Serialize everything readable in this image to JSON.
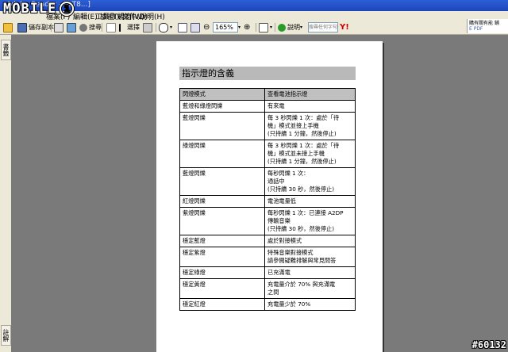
{
  "logo": {
    "text": "MOBILE"
  },
  "window": {
    "title": "Adobe Reader - [DT8...]"
  },
  "menu": [
    "檔案(F)",
    "編輯(E)",
    "檢視(V)",
    "文件(D)",
    "工具(T)",
    "視窗(W)",
    "說明(H)"
  ],
  "toolbar": {
    "save_copy": "儲存副本",
    "search": "搜尋",
    "select": "選擇",
    "zoom_value": "165%",
    "help": "說明",
    "search_placeholder": "搜尋任何字句"
  },
  "right_panel": {
    "line1": "購有關有能 鋪",
    "line2": "E PDF"
  },
  "left_tabs": {
    "top": "書籤",
    "bottom": "註解"
  },
  "document": {
    "heading": "指示燈的含義",
    "headers": [
      "閃燈模式",
      "查看電池指示燈"
    ],
    "rows": [
      {
        "mode": "藍燈和綠燈閃爍",
        "desc": [
          "有來電"
        ]
      },
      {
        "mode": "藍燈閃爍",
        "desc": [
          "每 3 秒閃爍 1 次：處於「待",
          "機」模式並接上手機",
          "(只持續 1 分鐘，然後停止)"
        ]
      },
      {
        "mode": "綠燈閃爍",
        "desc": [
          "每 3 秒閃爍 1 次：處於「待",
          "機」模式並未接上手機",
          "(只持續 1 分鐘，然後停止)"
        ]
      },
      {
        "mode": "藍燈閃爍",
        "desc": [
          "每秒閃爍 1 次：",
          "通話中",
          "(只持續 30 秒，然後停止)"
        ]
      },
      {
        "mode": "紅燈閃爍",
        "desc": [
          "電池電量低"
        ]
      },
      {
        "mode": "紫燈閃爍",
        "desc": [
          "每秒閃爍 1 次：已連接 A2DP",
          "傳輸音樂",
          "(只持續 30 秒，然後停止)"
        ]
      },
      {
        "mode": "穩定藍燈",
        "desc": [
          "處於對接模式"
        ]
      },
      {
        "mode": "穩定紫燈",
        "desc": [
          "特殊音樂對接模式",
          "請參閱疑難排解與常見問答"
        ]
      },
      {
        "mode": "穩定綠燈",
        "desc": [
          "已充滿電"
        ]
      },
      {
        "mode": "穩定黃燈",
        "desc": [
          "充電量介於 70% 與充滿電",
          "之間"
        ]
      },
      {
        "mode": "穩定紅燈",
        "desc": [
          "充電量少於 70%"
        ]
      }
    ]
  },
  "watermark": "#60132"
}
